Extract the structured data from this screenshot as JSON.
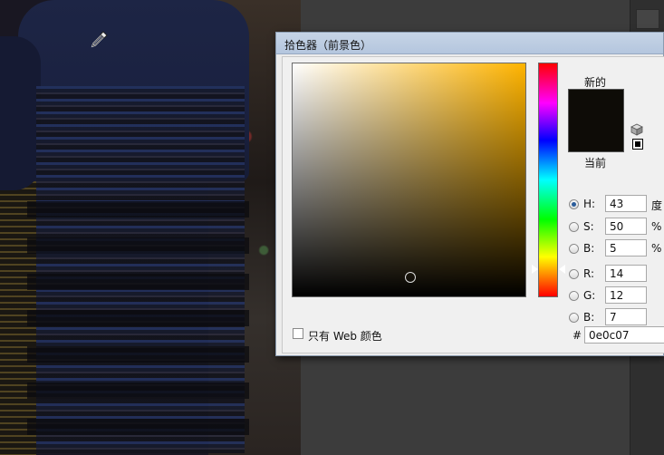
{
  "dialog": {
    "title": "拾色器（前景色）",
    "new_label": "新的",
    "current_label": "当前",
    "web_only_label": "只有 Web 颜色",
    "hex_prefix": "#",
    "hex_value": "0e0c07"
  },
  "colors": {
    "selected": "#0e0c07",
    "hue_base": "#ffb400"
  },
  "fields": [
    {
      "key": "H",
      "label": "H:",
      "value": "43",
      "unit": "度",
      "selected": true
    },
    {
      "key": "S",
      "label": "S:",
      "value": "50",
      "unit": "%",
      "selected": false
    },
    {
      "key": "Bv",
      "label": "B:",
      "value": "5",
      "unit": "%",
      "selected": false
    },
    {
      "key": "R",
      "label": "R:",
      "value": "14",
      "unit": "",
      "selected": false
    },
    {
      "key": "G",
      "label": "G:",
      "value": "12",
      "unit": "",
      "selected": false
    },
    {
      "key": "Bb",
      "label": "B:",
      "value": "7",
      "unit": "",
      "selected": false
    }
  ],
  "picker": {
    "saturation": 0.5,
    "brightness": 0.05,
    "hue_degrees": 43
  },
  "icons": {
    "eyedropper": "eyedropper-icon",
    "cube": "color-cube-icon",
    "swatch": "black-swatch-icon"
  }
}
